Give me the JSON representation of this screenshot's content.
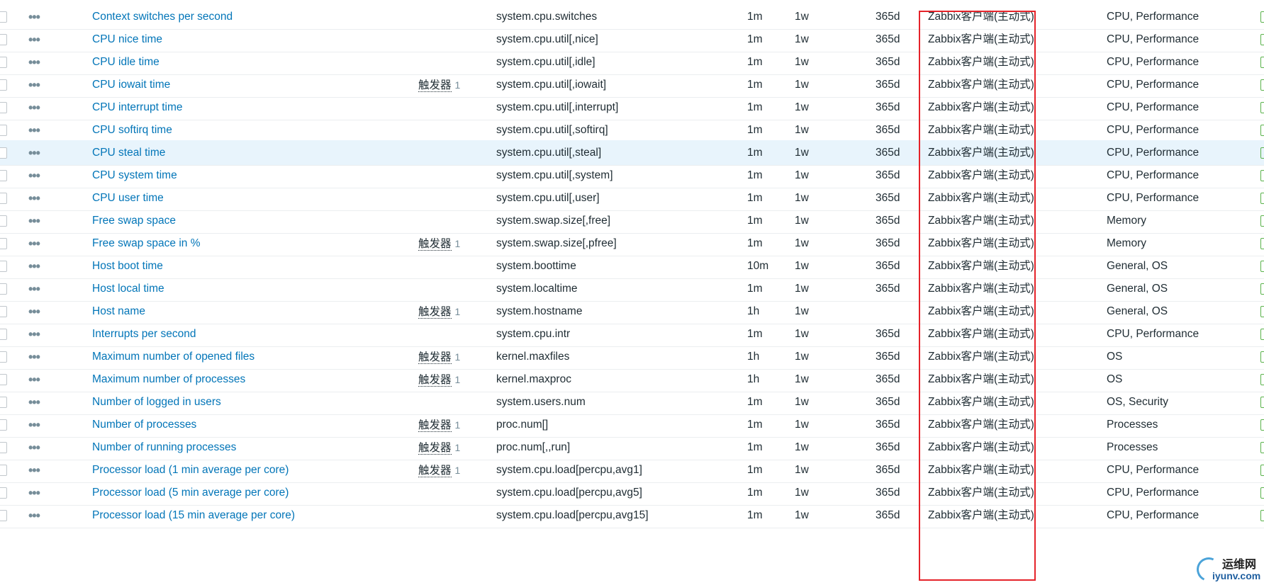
{
  "rows": [
    {
      "name": "Context switches per second",
      "trigger": "",
      "trigger_count": "",
      "key": "system.cpu.switches",
      "interval": "1m",
      "history": "1w",
      "trends": "365d",
      "type": "Zabbix客户端(主动式)",
      "tags": "CPU, Performance"
    },
    {
      "name": "CPU nice time",
      "trigger": "",
      "trigger_count": "",
      "key": "system.cpu.util[,nice]",
      "interval": "1m",
      "history": "1w",
      "trends": "365d",
      "type": "Zabbix客户端(主动式)",
      "tags": "CPU, Performance"
    },
    {
      "name": "CPU idle time",
      "trigger": "",
      "trigger_count": "",
      "key": "system.cpu.util[,idle]",
      "interval": "1m",
      "history": "1w",
      "trends": "365d",
      "type": "Zabbix客户端(主动式)",
      "tags": "CPU, Performance"
    },
    {
      "name": "CPU iowait time",
      "trigger": "触发器",
      "trigger_count": "1",
      "key": "system.cpu.util[,iowait]",
      "interval": "1m",
      "history": "1w",
      "trends": "365d",
      "type": "Zabbix客户端(主动式)",
      "tags": "CPU, Performance"
    },
    {
      "name": "CPU interrupt time",
      "trigger": "",
      "trigger_count": "",
      "key": "system.cpu.util[,interrupt]",
      "interval": "1m",
      "history": "1w",
      "trends": "365d",
      "type": "Zabbix客户端(主动式)",
      "tags": "CPU, Performance"
    },
    {
      "name": "CPU softirq time",
      "trigger": "",
      "trigger_count": "",
      "key": "system.cpu.util[,softirq]",
      "interval": "1m",
      "history": "1w",
      "trends": "365d",
      "type": "Zabbix客户端(主动式)",
      "tags": "CPU, Performance"
    },
    {
      "name": "CPU steal time",
      "trigger": "",
      "trigger_count": "",
      "key": "system.cpu.util[,steal]",
      "interval": "1m",
      "history": "1w",
      "trends": "365d",
      "type": "Zabbix客户端(主动式)",
      "tags": "CPU, Performance",
      "highlighted": true
    },
    {
      "name": "CPU system time",
      "trigger": "",
      "trigger_count": "",
      "key": "system.cpu.util[,system]",
      "interval": "1m",
      "history": "1w",
      "trends": "365d",
      "type": "Zabbix客户端(主动式)",
      "tags": "CPU, Performance"
    },
    {
      "name": "CPU user time",
      "trigger": "",
      "trigger_count": "",
      "key": "system.cpu.util[,user]",
      "interval": "1m",
      "history": "1w",
      "trends": "365d",
      "type": "Zabbix客户端(主动式)",
      "tags": "CPU, Performance"
    },
    {
      "name": "Free swap space",
      "trigger": "",
      "trigger_count": "",
      "key": "system.swap.size[,free]",
      "interval": "1m",
      "history": "1w",
      "trends": "365d",
      "type": "Zabbix客户端(主动式)",
      "tags": "Memory"
    },
    {
      "name": "Free swap space in %",
      "trigger": "触发器",
      "trigger_count": "1",
      "key": "system.swap.size[,pfree]",
      "interval": "1m",
      "history": "1w",
      "trends": "365d",
      "type": "Zabbix客户端(主动式)",
      "tags": "Memory"
    },
    {
      "name": "Host boot time",
      "trigger": "",
      "trigger_count": "",
      "key": "system.boottime",
      "interval": "10m",
      "history": "1w",
      "trends": "365d",
      "type": "Zabbix客户端(主动式)",
      "tags": "General, OS"
    },
    {
      "name": "Host local time",
      "trigger": "",
      "trigger_count": "",
      "key": "system.localtime",
      "interval": "1m",
      "history": "1w",
      "trends": "365d",
      "type": "Zabbix客户端(主动式)",
      "tags": "General, OS"
    },
    {
      "name": "Host name",
      "trigger": "触发器",
      "trigger_count": "1",
      "key": "system.hostname",
      "interval": "1h",
      "history": "1w",
      "trends": "",
      "type": "Zabbix客户端(主动式)",
      "tags": "General, OS"
    },
    {
      "name": "Interrupts per second",
      "trigger": "",
      "trigger_count": "",
      "key": "system.cpu.intr",
      "interval": "1m",
      "history": "1w",
      "trends": "365d",
      "type": "Zabbix客户端(主动式)",
      "tags": "CPU, Performance"
    },
    {
      "name": "Maximum number of opened files",
      "trigger": "触发器",
      "trigger_count": "1",
      "key": "kernel.maxfiles",
      "interval": "1h",
      "history": "1w",
      "trends": "365d",
      "type": "Zabbix客户端(主动式)",
      "tags": "OS"
    },
    {
      "name": "Maximum number of processes",
      "trigger": "触发器",
      "trigger_count": "1",
      "key": "kernel.maxproc",
      "interval": "1h",
      "history": "1w",
      "trends": "365d",
      "type": "Zabbix客户端(主动式)",
      "tags": "OS"
    },
    {
      "name": "Number of logged in users",
      "trigger": "",
      "trigger_count": "",
      "key": "system.users.num",
      "interval": "1m",
      "history": "1w",
      "trends": "365d",
      "type": "Zabbix客户端(主动式)",
      "tags": "OS, Security"
    },
    {
      "name": "Number of processes",
      "trigger": "触发器",
      "trigger_count": "1",
      "key": "proc.num[]",
      "interval": "1m",
      "history": "1w",
      "trends": "365d",
      "type": "Zabbix客户端(主动式)",
      "tags": "Processes"
    },
    {
      "name": "Number of running processes",
      "trigger": "触发器",
      "trigger_count": "1",
      "key": "proc.num[,,run]",
      "interval": "1m",
      "history": "1w",
      "trends": "365d",
      "type": "Zabbix客户端(主动式)",
      "tags": "Processes"
    },
    {
      "name": "Processor load (1 min average per core)",
      "trigger": "触发器",
      "trigger_count": "1",
      "key": "system.cpu.load[percpu,avg1]",
      "interval": "1m",
      "history": "1w",
      "trends": "365d",
      "type": "Zabbix客户端(主动式)",
      "tags": "CPU, Performance"
    },
    {
      "name": "Processor load (5 min average per core)",
      "trigger": "",
      "trigger_count": "",
      "key": "system.cpu.load[percpu,avg5]",
      "interval": "1m",
      "history": "1w",
      "trends": "365d",
      "type": "Zabbix客户端(主动式)",
      "tags": "CPU, Performance"
    },
    {
      "name": "Processor load (15 min average per core)",
      "trigger": "",
      "trigger_count": "",
      "key": "system.cpu.load[percpu,avg15]",
      "interval": "1m",
      "history": "1w",
      "trends": "365d",
      "type": "Zabbix客户端(主动式)",
      "tags": "CPU, Performance"
    }
  ],
  "watermark": {
    "cn": "运维网",
    "url": "iyunv.com"
  },
  "colors": {
    "link": "#0275b8",
    "highlight_box": "#e5232a",
    "row_highlight": "#e8f4fc"
  }
}
